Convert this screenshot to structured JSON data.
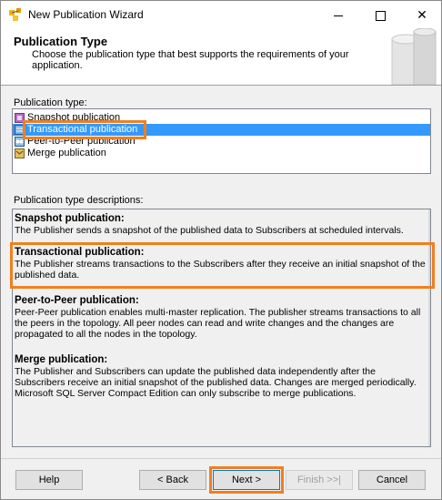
{
  "window": {
    "title": "New Publication Wizard"
  },
  "header": {
    "title": "Publication Type",
    "subtitle": "Choose the publication type that best supports the requirements of your application."
  },
  "publication_type": {
    "label": "Publication type:",
    "items": [
      {
        "label": "Snapshot publication",
        "icon": "snapshot-publication-icon",
        "selected": false
      },
      {
        "label": "Transactional publication",
        "icon": "transactional-publication-icon",
        "selected": true
      },
      {
        "label": "Peer-to-Peer publication",
        "icon": "peer-to-peer-publication-icon",
        "selected": false
      },
      {
        "label": "Merge publication",
        "icon": "merge-publication-icon",
        "selected": false
      }
    ]
  },
  "descriptions": {
    "label": "Publication type descriptions:",
    "sections": [
      {
        "heading": "Snapshot publication:",
        "body": "The Publisher sends a snapshot of the published data to Subscribers at scheduled intervals."
      },
      {
        "heading": "Transactional publication:",
        "body": "The Publisher streams transactions to the Subscribers after they receive an initial snapshot of the published data."
      },
      {
        "heading": "Peer-to-Peer publication:",
        "body": "Peer-Peer publication enables multi-master replication. The publisher streams transactions to all the peers in the topology. All peer nodes can read and write changes and the changes are propagated to all the nodes in the topology."
      },
      {
        "heading": "Merge publication:",
        "body": "The Publisher and Subscribers can update the published data independently after the Subscribers receive an initial snapshot of the published data. Changes are merged periodically. Microsoft SQL Server Compact Edition can only subscribe to merge publications."
      }
    ]
  },
  "buttons": {
    "help": "Help",
    "back": "< Back",
    "next": "Next >",
    "finish": "Finish >>|",
    "cancel": "Cancel"
  },
  "colors": {
    "highlight": "#f07f1e",
    "selection": "#3399ff",
    "primary_border": "#0078d7"
  }
}
